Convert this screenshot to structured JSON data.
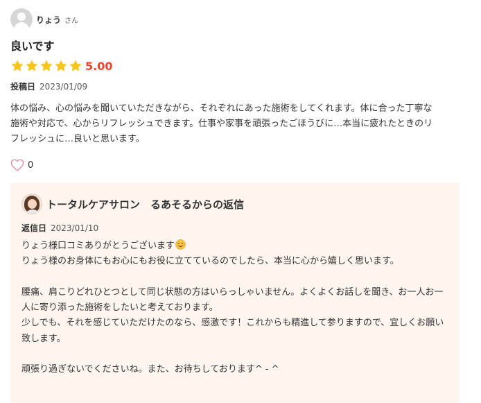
{
  "reviewer": {
    "name": "りょう",
    "suffix": "さん",
    "avatar_icon": "user-avatar-icon"
  },
  "review": {
    "title": "良いです",
    "rating": 5,
    "rating_max": 5,
    "score_label": "5.00",
    "star_color": "#f5c518",
    "score_color": "#e8452c",
    "posted_label": "投稿日",
    "posted_date": "2023/01/09",
    "body": "体の悩み、心の悩みを聞いていただきながら、それぞれにあった施術をしてくれます。体に合った丁寧な施術や対応で、心からリフレッシュできます。仕事や家事を頑張ったごほうびに…本当に疲れたときのリフレッシュに…良いと思います。",
    "like_icon": "heart-icon",
    "like_count": "0"
  },
  "reply": {
    "background": "#fdf5ee",
    "title": "トータルケアサロン　るあそるからの返信",
    "replied_label": "返信日",
    "replied_date": "2023/01/10",
    "first_line": "りょう様口コミありがとうございます",
    "emoji_icon": "smiling-face-emoji-icon",
    "body": "\nりょう様のお身体にもお心にもお役に立てているのでしたら、本当に心から嬉しく思います。\n\n腰痛、肩こりどれひとつとして同じ状態の方はいらっしゃいません。よくよくお話しを聞き、お一人お一人に寄り添った施術をしたいと考えております。\n少しでも、それを感じていただけたのなら、感激です！これからも精進して参りますので、宜しくお願い致します。\n\n頑張り過ぎないでくださいね。また、お待ちしております^ - ^"
  }
}
